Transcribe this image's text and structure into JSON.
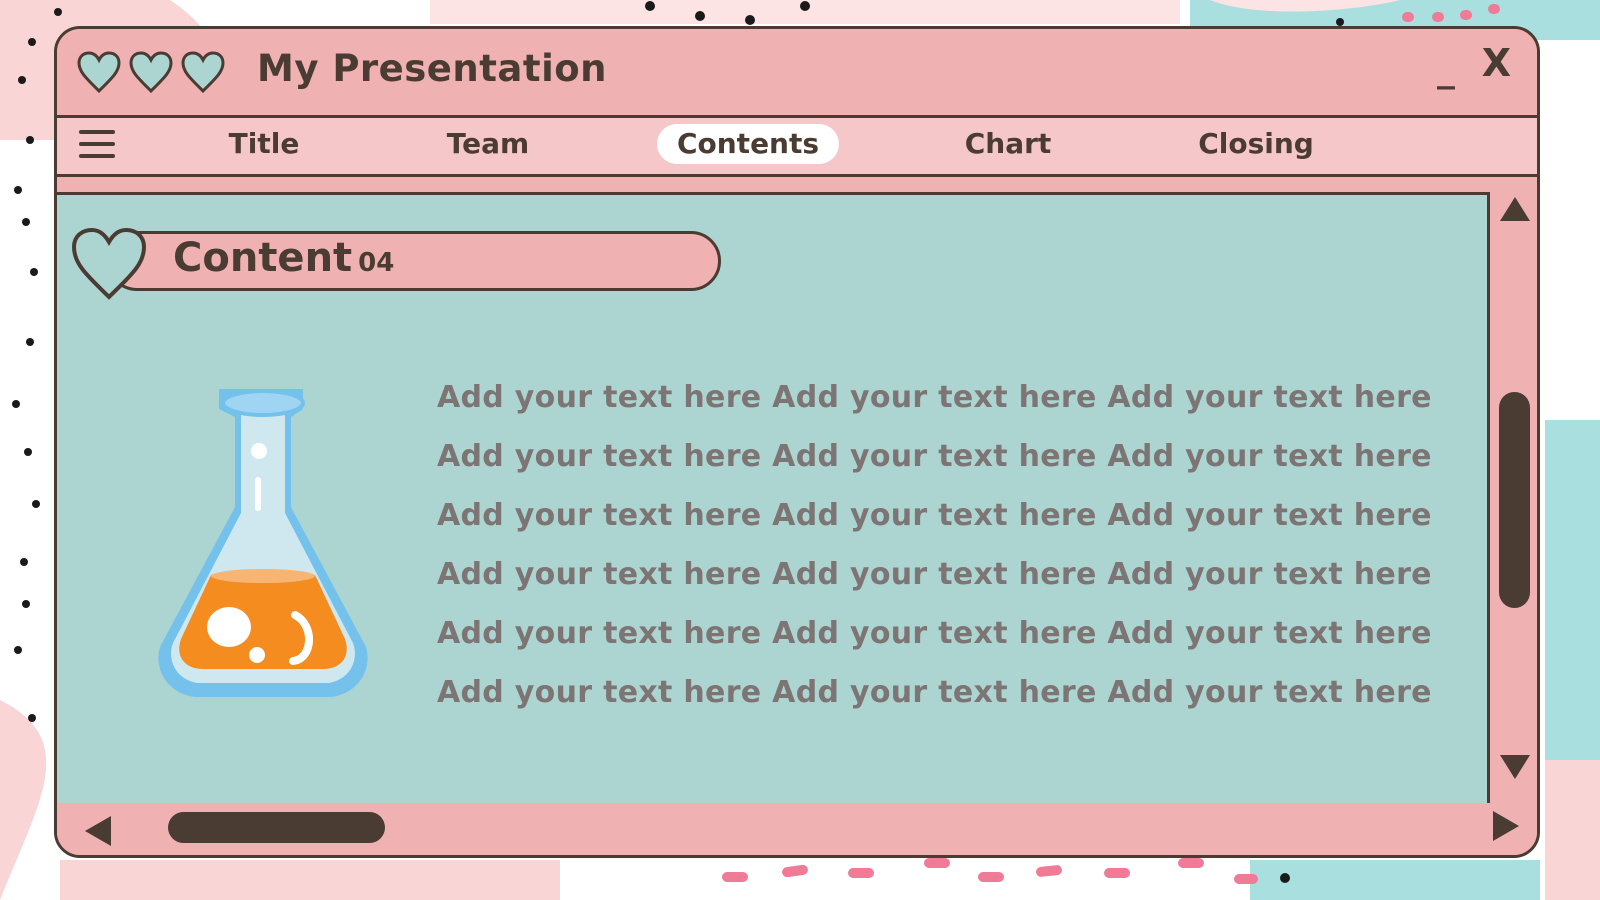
{
  "window": {
    "title": "My Presentation",
    "minimize_label": "_",
    "close_label": "X",
    "hearts": [
      "heart-icon",
      "heart-icon",
      "heart-icon"
    ]
  },
  "nav": {
    "tabs": [
      {
        "label": "Title",
        "active": false
      },
      {
        "label": "Team",
        "active": false
      },
      {
        "label": "Contents",
        "active": true
      },
      {
        "label": "Chart",
        "active": false
      },
      {
        "label": "Closing",
        "active": false
      }
    ]
  },
  "content": {
    "section_title": "Content",
    "section_number": "04",
    "lines": [
      "Add your text here Add your text here Add your text here",
      "Add your text here Add your text here Add your text here",
      "Add your text here Add your text here Add your text here",
      "Add your text here Add your text here Add your text here",
      "Add your text here Add your text here Add your text here",
      "Add your text here Add your text here Add your text here"
    ],
    "illustration": "flask-icon"
  },
  "colors": {
    "pink": "#efb1b1",
    "light_pink": "#f6c7c8",
    "teal": "#acd5d2",
    "dark_brown": "#4a3b33",
    "body_text": "#7d7474",
    "flask_blue": "#74c1ec",
    "liquid_orange": "#f48c1f"
  }
}
